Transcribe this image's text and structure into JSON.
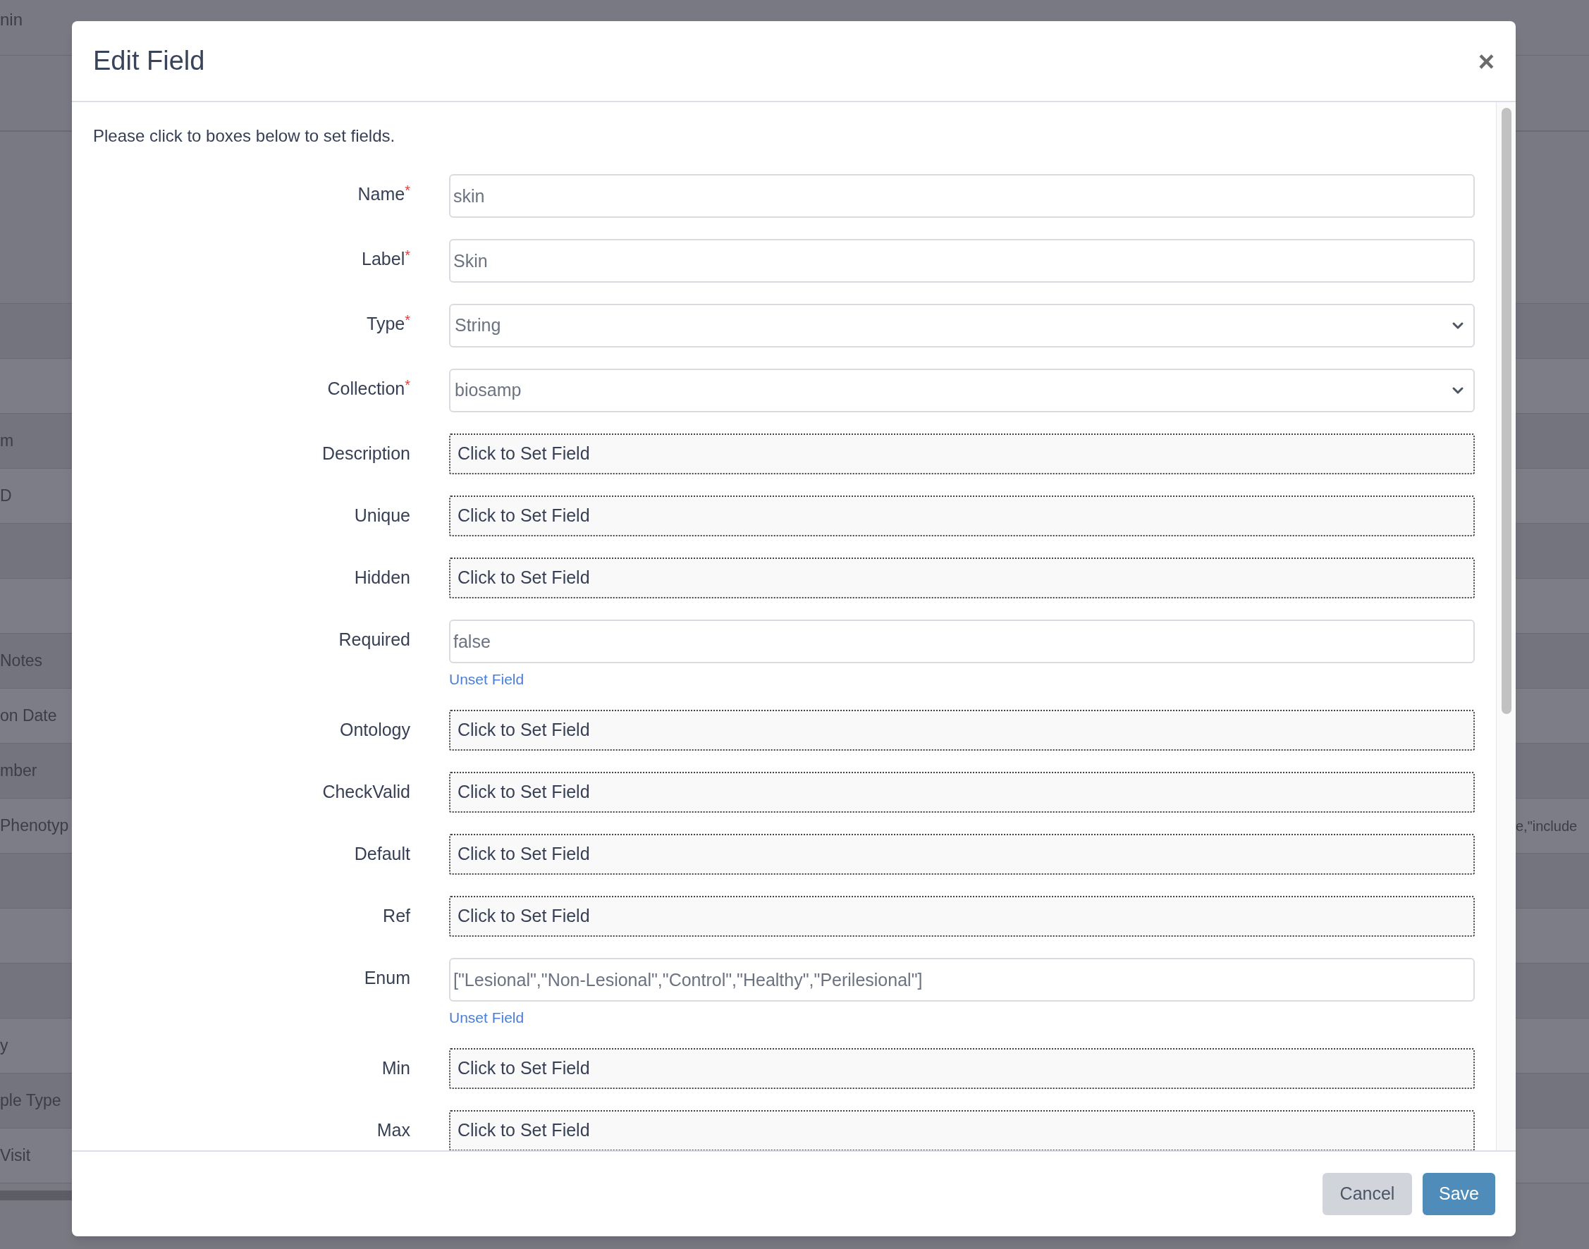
{
  "background": {
    "top_left": "nin",
    "rows": [
      {},
      {},
      {
        "left": "m"
      },
      {
        "left": "D"
      },
      {},
      {},
      {
        "left": "Notes"
      },
      {
        "left": "on Date"
      },
      {
        "left": "mber"
      },
      {
        "left": "Phenotyp",
        "right": "e,\"include"
      },
      {},
      {},
      {},
      {
        "left": "y"
      },
      {
        "left": "ple Type"
      },
      {
        "left": "Visit"
      }
    ]
  },
  "dialog": {
    "title": "Edit Field",
    "close": "×",
    "instructions": "Please click to boxes below to set fields.",
    "fields": [
      {
        "label": "Name",
        "required_mark": "*",
        "kind": "input",
        "value": "skin"
      },
      {
        "label": "Label",
        "required_mark": "*",
        "kind": "input",
        "value": "Skin"
      },
      {
        "label": "Type",
        "required_mark": "*",
        "kind": "select",
        "value": "String"
      },
      {
        "label": "Collection",
        "required_mark": "*",
        "kind": "select",
        "value": "biosamp"
      },
      {
        "label": "Description",
        "kind": "unset",
        "value": "Click to Set Field"
      },
      {
        "label": "Unique",
        "kind": "unset",
        "value": "Click to Set Field"
      },
      {
        "label": "Hidden",
        "kind": "unset",
        "value": "Click to Set Field"
      },
      {
        "label": "Required",
        "kind": "input",
        "value": "false",
        "link": "Unset Field"
      },
      {
        "label": "Ontology",
        "kind": "unset",
        "value": "Click to Set Field"
      },
      {
        "label": "CheckValid",
        "kind": "unset",
        "value": "Click to Set Field"
      },
      {
        "label": "Default",
        "kind": "unset",
        "value": "Click to Set Field"
      },
      {
        "label": "Ref",
        "kind": "unset",
        "value": "Click to Set Field"
      },
      {
        "label": "Enum",
        "kind": "input",
        "value": "[\"Lesional\",\"Non-Lesional\",\"Control\",\"Healthy\",\"Perilesional\"]",
        "link": "Unset Field"
      },
      {
        "label": "Min",
        "kind": "unset",
        "value": "Click to Set Field"
      },
      {
        "label": "Max",
        "kind": "unset",
        "value": "Click to Set Field"
      }
    ],
    "buttons": [
      {
        "label": "Cancel",
        "kind": "secondary"
      },
      {
        "label": "Save",
        "kind": "primary"
      }
    ]
  }
}
